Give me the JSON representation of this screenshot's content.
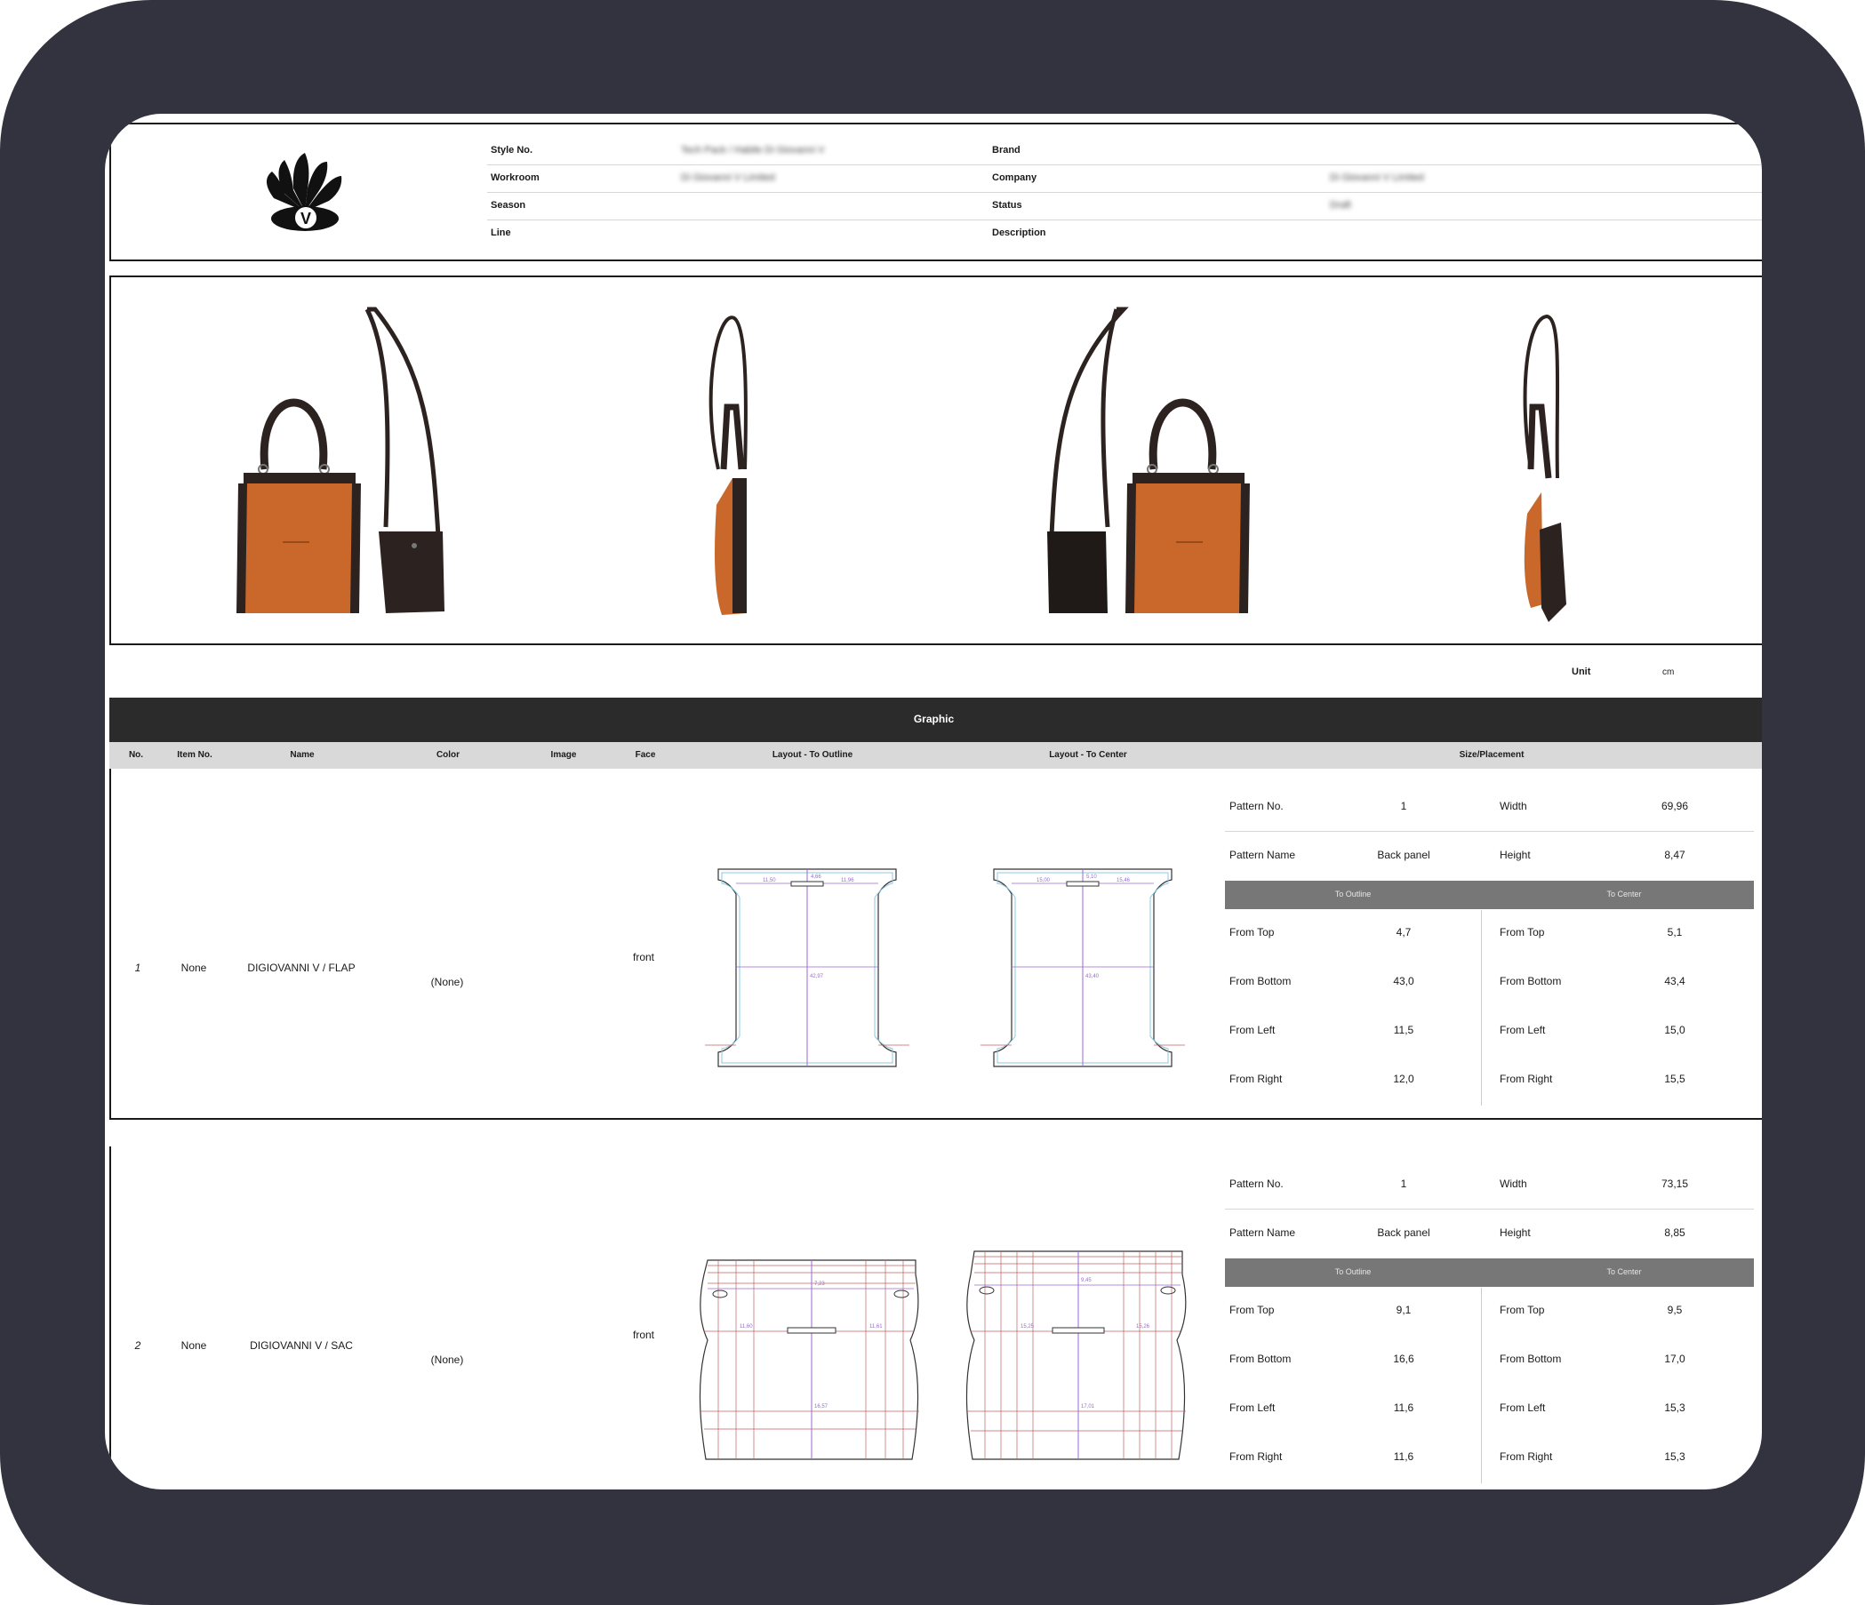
{
  "header": {
    "fields": [
      {
        "label": "Style No.",
        "value": "Tech Pack / Habile Di Giovanni V"
      },
      {
        "label": "Workroom",
        "value": "Di Giovanni V Limited"
      },
      {
        "label": "Season",
        "value": ""
      },
      {
        "label": "Line",
        "value": ""
      },
      {
        "label": "Brand",
        "value": ""
      },
      {
        "label": "Company",
        "value": "Di Giovanni V Limited"
      },
      {
        "label": "Status",
        "value": "Draft"
      },
      {
        "label": "Description",
        "value": ""
      }
    ],
    "logo_letter": "V",
    "logo_icon": "shell-logo-icon"
  },
  "unit": {
    "label": "Unit",
    "value": "cm"
  },
  "graphic": {
    "title": "Graphic",
    "columns": [
      "No.",
      "Item No.",
      "Name",
      "Color",
      "Image",
      "Face",
      "Layout - To Outline",
      "Layout - To Center",
      "Size/Placement"
    ],
    "placement_labels": {
      "pattern_no": "Pattern No.",
      "pattern_name": "Pattern Name",
      "width": "Width",
      "height": "Height",
      "to_outline": "To Outline",
      "to_center": "To Center",
      "from_top": "From Top",
      "from_bottom": "From Bottom",
      "from_left": "From Left",
      "from_right": "From Right"
    },
    "rows": [
      {
        "no": "1",
        "item_no": "None",
        "name": "DIGIOVANNI V / FLAP",
        "color": "(None)",
        "face": "front",
        "pattern_no": "1",
        "pattern_name": "Back panel",
        "width": "69,96",
        "height": "8,47",
        "outline": {
          "top": "4,7",
          "bottom": "43,0",
          "left": "11,5",
          "right": "12,0"
        },
        "center": {
          "top": "5,1",
          "bottom": "43,4",
          "left": "15,0",
          "right": "15,5"
        },
        "dims_outline": {
          "top": "4,66",
          "left": "11,50",
          "right": "11,96",
          "center": "42,97"
        },
        "dims_center": {
          "top": "5,10",
          "left": "15,00",
          "right": "15,46",
          "center": "43,40"
        }
      },
      {
        "no": "2",
        "item_no": "None",
        "name": "DIGIOVANNI V / SAC",
        "color": "(None)",
        "face": "front",
        "pattern_no": "1",
        "pattern_name": "Back panel",
        "width": "73,15",
        "height": "8,85",
        "outline": {
          "top": "9,1",
          "bottom": "16,6",
          "left": "11,6",
          "right": "11,6"
        },
        "center": {
          "top": "9,5",
          "bottom": "17,0",
          "left": "15,3",
          "right": "15,3"
        },
        "dims_outline": {
          "top": "7,23",
          "left": "11,60",
          "right": "11,61",
          "center": "16,57"
        },
        "dims_center": {
          "top": "9,45",
          "left": "15,25",
          "right": "15,26",
          "center": "17,01"
        }
      }
    ]
  },
  "colors": {
    "accent_bar": "#2b2b2b",
    "subheader": "#d9d9d9",
    "grey_bar": "#777777",
    "leather": "#c9682a",
    "dark": "#2c2320"
  }
}
